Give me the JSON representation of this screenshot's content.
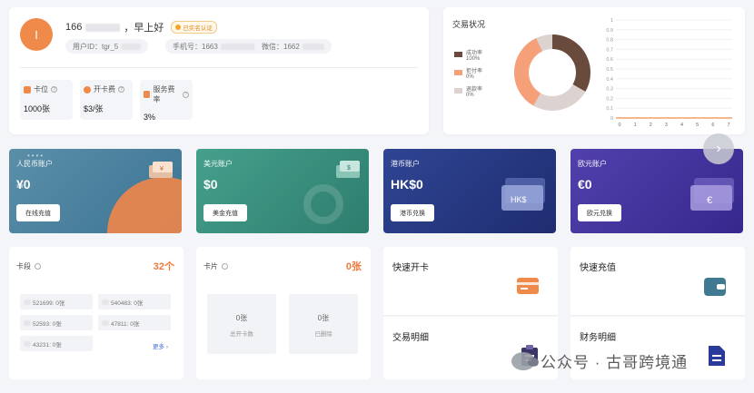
{
  "profile": {
    "avatar_letter": "I",
    "greeting_prefix": "166",
    "greeting_suffix": "，早上好",
    "verified_badge": "已实名认证",
    "user_id_label": "用户ID：tgr_5",
    "phone_label": "手机号：1663",
    "wechat_label": "微信：1662",
    "stats": [
      {
        "label": "卡位",
        "value": "1000张",
        "icon_color": "#f08a4b"
      },
      {
        "label": "开卡费",
        "value": "$3/张",
        "icon_color": "#f08a4b"
      },
      {
        "label": "服务费率",
        "value": "3%",
        "icon_color": "#f08a4b"
      }
    ]
  },
  "trade": {
    "title": "交易状况",
    "legend": [
      {
        "name": "成功率",
        "value": "100%",
        "color": "#6b4a3e"
      },
      {
        "name": "拒付率",
        "value": "0%",
        "color": "#f6a07a"
      },
      {
        "name": "退款率",
        "value": "0%",
        "color": "#dcd2cf"
      }
    ],
    "y_ticks": [
      "1",
      "0.9",
      "0.8",
      "0.7",
      "0.6",
      "0.5",
      "0.4",
      "0.3",
      "0.2",
      "0.1",
      "0"
    ],
    "x_ticks": [
      "0",
      "1",
      "2",
      "3",
      "4",
      "5",
      "6",
      "7"
    ]
  },
  "accounts": [
    {
      "title": "人民币账户",
      "value": "¥0",
      "button": "在线充值",
      "color_from": "#4f8aa8",
      "color_to": "#2f6a8a"
    },
    {
      "title": "美元账户",
      "value": "$0",
      "button": "美金充值",
      "color_from": "#3f9a8a",
      "color_to": "#2a7a6e"
    },
    {
      "title": "港币账户",
      "value": "HK$0",
      "button": "港币兑换",
      "color_from": "#2c3f8c",
      "color_to": "#1d2a6e"
    },
    {
      "title": "欧元账户",
      "value": "€0",
      "button": "欧元兑换",
      "color_from": "#4b3aa5",
      "color_to": "#33278a"
    }
  ],
  "card_segments": {
    "title": "卡段",
    "count": "32个",
    "items": [
      "521699: 0张",
      "540483: 0张",
      "52593: 0张",
      "47811: 0张",
      "43231: 0张"
    ],
    "more": "更多"
  },
  "cards": {
    "title": "卡片",
    "count": "0张",
    "boxes": [
      {
        "value": "0张",
        "desc": "总开卡数"
      },
      {
        "value": "0张",
        "desc": "已删除"
      }
    ]
  },
  "quick": {
    "open_card": "快速开卡",
    "recharge": "快速充值",
    "transactions": "交易明细",
    "finance": "财务明细"
  },
  "watermark": "公众号 · 古哥跨境通"
}
